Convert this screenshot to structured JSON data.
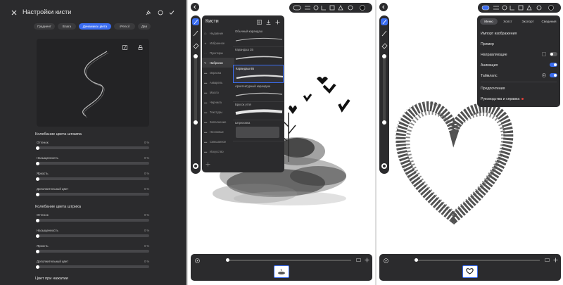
{
  "left_panel": {
    "title": "Настройки кисти",
    "tabs": [
      {
        "label": "Градиент"
      },
      {
        "label": "Влага"
      },
      {
        "label": "Динамика цвета",
        "active": true
      },
      {
        "label": "iPencil"
      },
      {
        "label": "Дав"
      }
    ],
    "section_stamp": {
      "title": "Колебание цвета штампа",
      "rows": [
        {
          "label": "Оттенок",
          "value": "0 %",
          "level": 0
        },
        {
          "label": "Насыщенность",
          "value": "0 %",
          "level": 0
        },
        {
          "label": "Яркость",
          "value": "0 %",
          "level": 0
        },
        {
          "label": "Дополнительный цвет",
          "value": "0 %",
          "level": 0
        }
      ]
    },
    "section_stroke": {
      "title": "Колебание цвета штриха",
      "rows": [
        {
          "label": "Оттенок",
          "value": "0 %",
          "level": 0
        },
        {
          "label": "Насыщенность",
          "value": "0 %",
          "level": 0
        },
        {
          "label": "Яркость",
          "value": "0 %",
          "level": 0
        },
        {
          "label": "Дополнительный цвет",
          "value": "0 %",
          "level": 0
        }
      ]
    },
    "section_pressure_title": "Цвет при нажатии"
  },
  "middle_panel": {
    "brushes_title": "Кисти",
    "brush_sets": [
      {
        "label": "Недавние"
      },
      {
        "label": "Избранное"
      },
      {
        "label": "Пунктиры"
      },
      {
        "label": "Наброски",
        "active": true
      },
      {
        "label": "Окраска"
      },
      {
        "label": "Акварель"
      },
      {
        "label": "Масло"
      },
      {
        "label": "Чернила"
      },
      {
        "label": "Текстуры"
      },
      {
        "label": "Заполнение"
      },
      {
        "label": "Неоновые"
      },
      {
        "label": "Смешанное"
      },
      {
        "label": "Искусство"
      }
    ],
    "brushes": [
      {
        "label": "Обычный карандаш"
      },
      {
        "label": "Карандаш 2Б"
      },
      {
        "label": "Карандаш 6Б",
        "active": true
      },
      {
        "label": "Архитектурный карандаш"
      },
      {
        "label": "Брусок угля"
      },
      {
        "label": "Штриховка"
      }
    ]
  },
  "right_panel": {
    "tabs": [
      {
        "label": "Меню",
        "active": true
      },
      {
        "label": "Холст"
      },
      {
        "label": "Экспорт"
      },
      {
        "label": "Сведения"
      }
    ],
    "menu_rows": [
      {
        "label": "Импорт изображения"
      },
      {
        "label": "Пример"
      },
      {
        "label": "Направляющие"
      },
      {
        "label": "Анимация"
      },
      {
        "label": "Таймлапс"
      },
      {
        "label": "Предпочтения"
      },
      {
        "label": "Руководства и справка"
      }
    ],
    "toggles": {
      "guides": false,
      "animation": true,
      "timelapse": true
    }
  },
  "colors": {
    "panel_bg": "#2b2b2d",
    "accent": "#3b6df0",
    "divider": "#dcdcdc"
  }
}
